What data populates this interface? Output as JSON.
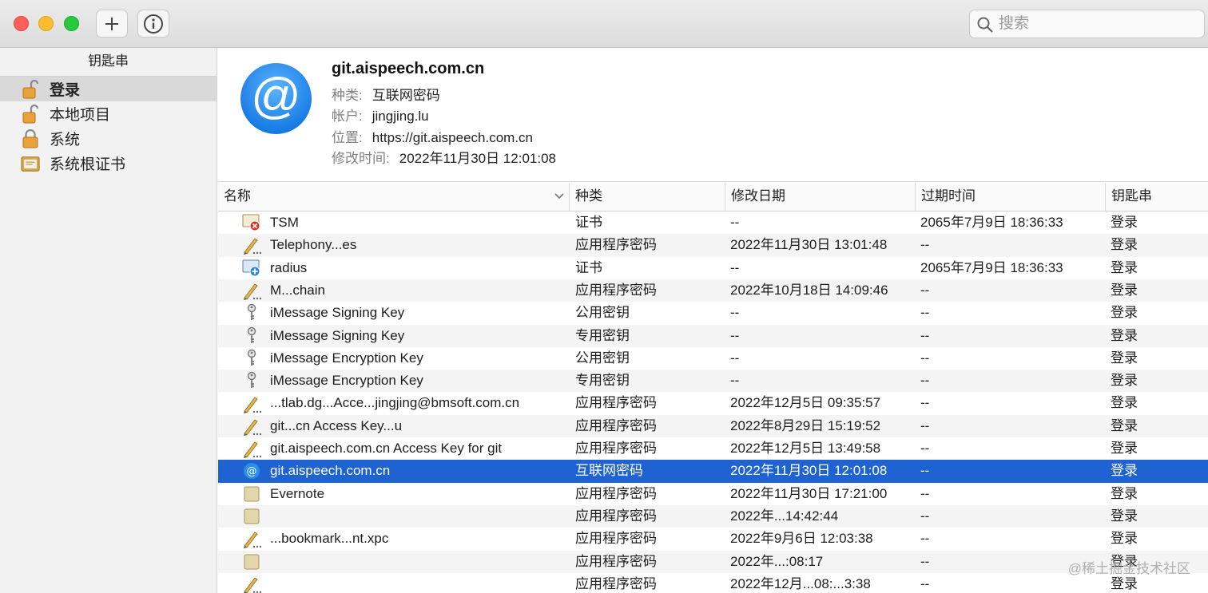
{
  "toolbar": {
    "add_label": "+",
    "search_placeholder": "搜索"
  },
  "sidebar": {
    "header": "钥匙串",
    "items": [
      {
        "label": "登录",
        "icon": "lock-open-icon"
      },
      {
        "label": "本地项目",
        "icon": "lock-open-icon"
      },
      {
        "label": "系统",
        "icon": "lock-icon"
      },
      {
        "label": "系统根证书",
        "icon": "certificate-folder-icon"
      }
    ]
  },
  "detail": {
    "title": "git.aispeech.com.cn",
    "kind_label": "种类:",
    "kind_value": "互联网密码",
    "account_label": "帐户:",
    "account_value": "jingjing.lu",
    "location_label": "位置:",
    "location_value": "https://git.aispeech.com.cn",
    "modified_label": "修改时间:",
    "modified_value": "2022年11月30日 12:01:08"
  },
  "table": {
    "columns": {
      "name": "名称",
      "kind": "种类",
      "modified": "修改日期",
      "expires": "过期时间",
      "keychain": "钥匙串"
    },
    "rows": [
      {
        "icon": "certificate-error-icon",
        "name": "TSM",
        "kind": "证书",
        "modified": "--",
        "expires": "2065年7月9日 18:36:33",
        "keychain": "登录"
      },
      {
        "icon": "pencil-note-icon",
        "name": "Telephony...es",
        "kind": "应用程序密码",
        "modified": "2022年11月30日 13:01:48",
        "expires": "--",
        "keychain": "登录"
      },
      {
        "icon": "certificate-plus-icon",
        "name": "radius",
        "kind": "证书",
        "modified": "--",
        "expires": "2065年7月9日 18:36:33",
        "keychain": "登录"
      },
      {
        "icon": "pencil-note-icon",
        "name": "M...chain",
        "kind": "应用程序密码",
        "modified": "2022年10月18日 14:09:46",
        "expires": "--",
        "keychain": "登录"
      },
      {
        "icon": "key-icon",
        "name": "iMessage Signing Key",
        "kind": "公用密钥",
        "modified": "--",
        "expires": "--",
        "keychain": "登录"
      },
      {
        "icon": "key-icon",
        "name": "iMessage Signing Key",
        "kind": "专用密钥",
        "modified": "--",
        "expires": "--",
        "keychain": "登录"
      },
      {
        "icon": "key-icon",
        "name": "iMessage Encryption Key",
        "kind": "公用密钥",
        "modified": "--",
        "expires": "--",
        "keychain": "登录"
      },
      {
        "icon": "key-icon",
        "name": "iMessage Encryption Key",
        "kind": "专用密钥",
        "modified": "--",
        "expires": "--",
        "keychain": "登录"
      },
      {
        "icon": "pencil-note-icon",
        "name": "...tlab.dg...Acce...jingjing@bmsoft.com.cn",
        "kind": "应用程序密码",
        "modified": "2022年12月5日 09:35:57",
        "expires": "--",
        "keychain": "登录"
      },
      {
        "icon": "pencil-note-icon",
        "name": "git...cn Access Key...u",
        "kind": "应用程序密码",
        "modified": "2022年8月29日 15:19:52",
        "expires": "--",
        "keychain": "登录"
      },
      {
        "icon": "pencil-note-icon",
        "name": "git.aispeech.com.cn Access Key for git",
        "kind": "应用程序密码",
        "modified": "2022年12月5日 13:49:58",
        "expires": "--",
        "keychain": "登录"
      },
      {
        "icon": "at-icon",
        "name": "git.aispeech.com.cn",
        "kind": "互联网密码",
        "modified": "2022年11月30日 12:01:08",
        "expires": "--",
        "keychain": "登录",
        "selected": true
      },
      {
        "icon": "note-icon",
        "name": "Evernote",
        "kind": "应用程序密码",
        "modified": "2022年11月30日 17:21:00",
        "expires": "--",
        "keychain": "登录"
      },
      {
        "icon": "note-icon",
        "name": "",
        "kind": "应用程序密码",
        "modified": "2022年...14:42:44",
        "expires": "--",
        "keychain": "登录"
      },
      {
        "icon": "pencil-note-icon",
        "name": "...bookmark...nt.xpc",
        "kind": "应用程序密码",
        "modified": "2022年9月6日 12:03:38",
        "expires": "--",
        "keychain": "登录"
      },
      {
        "icon": "note-icon",
        "name": "",
        "kind": "应用程序密码",
        "modified": "2022年...:08:17",
        "expires": "--",
        "keychain": "登录"
      },
      {
        "icon": "pencil-note-icon",
        "name": "",
        "kind": "应用程序密码",
        "modified": "2022年12月...08:...3:38",
        "expires": "--",
        "keychain": "登录"
      }
    ]
  },
  "watermark": "@稀土掘金技术社区",
  "colors": {
    "selection": "#1f63d3",
    "accent_icon": "#1a7de6"
  }
}
